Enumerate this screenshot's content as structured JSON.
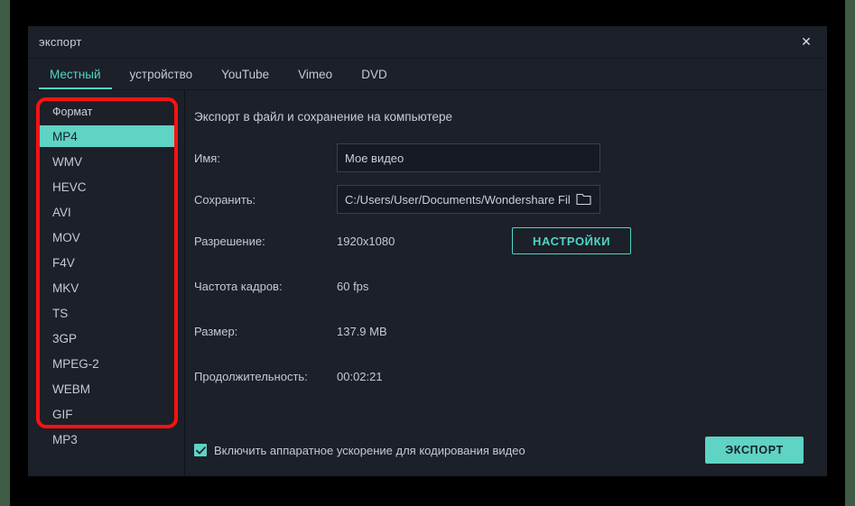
{
  "window": {
    "title": "экспорт",
    "close_label": "✕"
  },
  "tabs": [
    {
      "label": "Местный",
      "active": true
    },
    {
      "label": "устройство",
      "active": false
    },
    {
      "label": "YouTube",
      "active": false
    },
    {
      "label": "Vimeo",
      "active": false
    },
    {
      "label": "DVD",
      "active": false
    }
  ],
  "sidebar": {
    "header": "Формат",
    "selected": "MP4",
    "items": [
      "MP4",
      "WMV",
      "HEVC",
      "AVI",
      "MOV",
      "F4V",
      "MKV",
      "TS",
      "3GP",
      "MPEG-2",
      "WEBM",
      "GIF",
      "MP3"
    ]
  },
  "main": {
    "section_title": "Экспорт в файл и сохранение на компьютере",
    "fields": {
      "name_label": "Имя:",
      "name_value": "Мое видео",
      "save_label": "Сохранить:",
      "save_value": "C:/Users/User/Documents/Wondershare Film",
      "resolution_label": "Разрешение:",
      "resolution_value": "1920x1080",
      "settings_button": "НАСТРОЙКИ",
      "framerate_label": "Частота кадров:",
      "framerate_value": "60 fps",
      "size_label": "Размер:",
      "size_value": "137.9 MB",
      "duration_label": "Продолжительность:",
      "duration_value": "00:02:21"
    }
  },
  "footer": {
    "hardware_accel_label": "Включить аппаратное ускорение для кодирования видео",
    "hardware_accel_checked": true,
    "export_button": "ЭКСПОРТ"
  },
  "colors": {
    "accent": "#5fd3c4",
    "panel": "#1b2029",
    "field": "#151a23",
    "annotation": "#ff1111",
    "edge_strip": "#3e5c44"
  }
}
